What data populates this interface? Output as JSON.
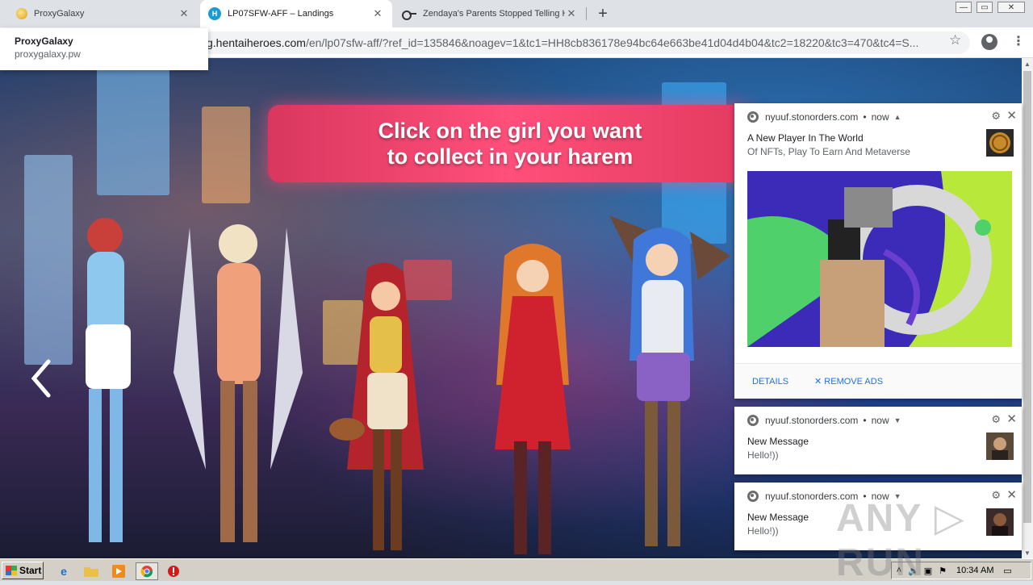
{
  "tabs": [
    {
      "title": "ProxyGalaxy",
      "icon": "proxygalaxy-favicon"
    },
    {
      "title": "LP07SFW-AFF – Landings",
      "icon": "hentaiheroes-favicon"
    },
    {
      "title": "Zendaya's Parents Stopped Telling H",
      "icon": "key-favicon"
    }
  ],
  "tab_close_glyph": "✕",
  "new_tab_glyph": "+",
  "window_controls": {
    "minimize": "—",
    "maximize": "▭",
    "close": "✕"
  },
  "hover_card": {
    "title": "ProxyGalaxy",
    "url": "proxygalaxy.pw"
  },
  "address_bar": {
    "prefix": "g.hentaiheroes.com",
    "rest": "/en/lp07sfw-aff/?ref_id=135846&noagev=1&tc1=HH8cb836178e94bc64e663be41d04d4b04&tc2=18220&tc3=470&tc4=S..."
  },
  "page": {
    "banner_text": "Click on the girl you want\nto collect in your harem",
    "prev_arrow": "previous-arrow"
  },
  "notifications": [
    {
      "origin": "nyuuf.stonorders.com",
      "time": "now",
      "title": "A New Player In The World",
      "body": "Of NFTs, Play To Earn And Metaverse",
      "expanded": true,
      "actions": [
        "DETAILS",
        "✕ REMOVE ADS"
      ]
    },
    {
      "origin": "nyuuf.stonorders.com",
      "time": "now",
      "title": "New Message",
      "body": "Hello!))",
      "expanded": false
    },
    {
      "origin": "nyuuf.stonorders.com",
      "time": "now",
      "title": "New Message",
      "body": "Hello!))",
      "expanded": false
    }
  ],
  "watermark": "ANY ▷ RUN",
  "taskbar": {
    "start_label": "Start",
    "clock": "10:34 AM"
  },
  "colors": {
    "banner": "#ff4f7a",
    "link": "#1a73e8",
    "taskbar": "#d4d0c8"
  }
}
